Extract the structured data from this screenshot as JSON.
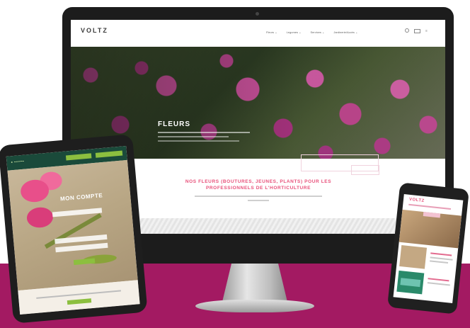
{
  "desktop": {
    "logo": "VOLTZ",
    "logo_tagline": "",
    "nav": [
      "Fleurs ⌄",
      "Legumes ⌄",
      "Services ⌄",
      "Jardinerie/Accès ⌄"
    ],
    "hero_title": "FLEURS",
    "headline": "NOS FLEURS (BOUTURES, JEUNES, PLANTS) POUR LES PROFESSIONNELS DE L'HORTICULTURE"
  },
  "tablet": {
    "title": "MON COMPTE"
  },
  "phone": {
    "logo": "VOLTZ"
  },
  "colors": {
    "brand_pink": "#e8507a",
    "floor_magenta": "#a31a62",
    "tablet_green": "#8cbf3f",
    "tablet_dark": "#1a4a3a"
  }
}
